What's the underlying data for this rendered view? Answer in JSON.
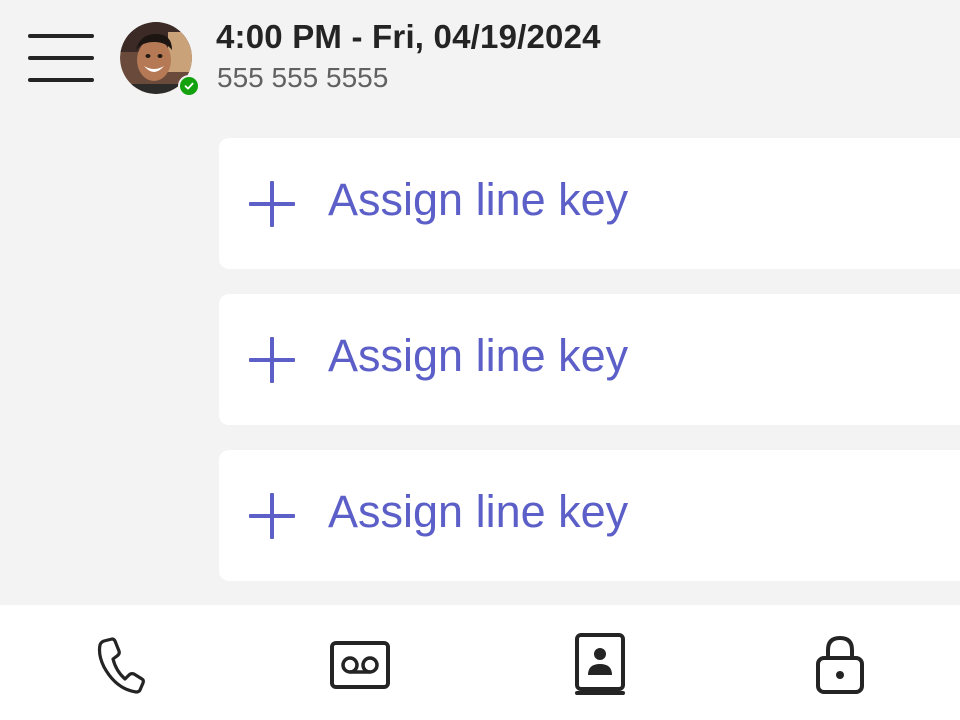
{
  "header": {
    "datetime": "4:00 PM - Fri, 04/19/2024",
    "phone_number": "555 555 5555",
    "presence_status_color": "#13a10e"
  },
  "line_keys": [
    {
      "label": "Assign line key",
      "icon": "plus-icon"
    },
    {
      "label": "Assign line key",
      "icon": "plus-icon"
    },
    {
      "label": "Assign line key",
      "icon": "plus-icon"
    }
  ],
  "bottom_nav": [
    {
      "icon": "phone-icon"
    },
    {
      "icon": "voicemail-icon"
    },
    {
      "icon": "contacts-book-icon"
    },
    {
      "icon": "lock-icon"
    }
  ],
  "colors": {
    "accent": "#5b5fc7",
    "background": "#f3f3f3",
    "card": "#ffffff",
    "text_primary": "#242424",
    "text_secondary": "#616161"
  }
}
